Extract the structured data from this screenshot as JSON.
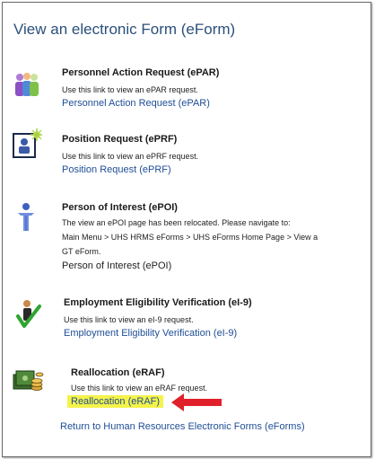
{
  "page": {
    "title": "View an electronic Form (eForm)"
  },
  "forms": [
    {
      "heading": "Personnel Action Request (ePAR)",
      "description": "Use this link to view an ePAR request.",
      "link": "Personnel Action Request (ePAR)",
      "icon": "people-group-icon"
    },
    {
      "heading": "Position Request (ePRF)",
      "description": "Use this link to view an ePRF request.",
      "link": "Position Request (ePRF)",
      "icon": "position-badge-icon"
    },
    {
      "heading": "Person of Interest (ePOI)",
      "description_lines": [
        "The view an ePOI page has been relocated. Please navigate to:",
        "Main Menu > UHS HRMS eForms > UHS eForms Home Page > View a",
        "GT eForm."
      ],
      "plain_text": "Person of Interest (ePOI)",
      "icon": "person-icon"
    },
    {
      "heading": "Employment Eligibility Verification (eI-9)",
      "description": "Use this link to view an eI-9 request.",
      "link": "Employment Eligibility Verification (eI-9)",
      "icon": "person-checkmark-icon"
    },
    {
      "heading": "Reallocation (eRAF)",
      "description": "Use this link to view an eRAF request.",
      "link": "Reallocation (eRAF)",
      "icon": "money-stack-icon"
    }
  ],
  "footer": {
    "return_link": "Return to Human Resources Electronic Forms (eForms)"
  },
  "colors": {
    "title": "#2b4f7a",
    "link": "#1f4e96",
    "highlight": "#f4f34a",
    "arrow": "#e0202a"
  }
}
